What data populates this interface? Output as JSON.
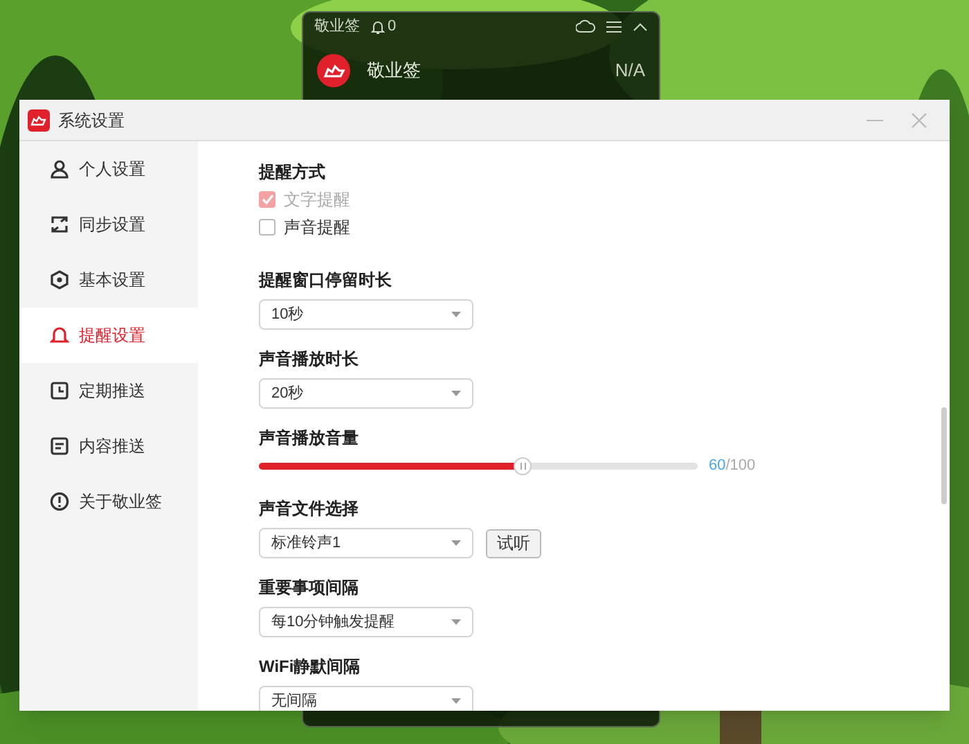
{
  "widget": {
    "title": "敬业签",
    "bell_count": "0",
    "name": "敬业签",
    "status": "N/A"
  },
  "window": {
    "title": "系统设置"
  },
  "sidebar": {
    "items": [
      {
        "label": "个人设置",
        "selected": false
      },
      {
        "label": "同步设置",
        "selected": false
      },
      {
        "label": "基本设置",
        "selected": false
      },
      {
        "label": "提醒设置",
        "selected": true
      },
      {
        "label": "定期推送",
        "selected": false
      },
      {
        "label": "内容推送",
        "selected": false
      },
      {
        "label": "关于敬业签",
        "selected": false
      }
    ]
  },
  "sections": [
    {
      "kind": "checks",
      "heading": "提醒方式",
      "options": [
        {
          "label": "文字提醒",
          "checked": true,
          "disabled": true
        },
        {
          "label": "声音提醒",
          "checked": false,
          "disabled": false
        }
      ]
    },
    {
      "kind": "select",
      "heading": "提醒窗口停留时长",
      "value": "10秒"
    },
    {
      "kind": "select",
      "heading": "声音播放时长",
      "value": "20秒"
    },
    {
      "kind": "slider",
      "heading": "声音播放音量",
      "level": 0.6,
      "reading": "60",
      "max": "/100"
    },
    {
      "kind": "select",
      "heading": "声音文件选择",
      "value": "标准铃声1",
      "button": "试听"
    },
    {
      "kind": "select",
      "heading": "重要事项间隔",
      "value": "每10分钟触发提醒"
    },
    {
      "kind": "select",
      "heading": "WiFi静默间隔",
      "value": "无间隔"
    }
  ]
}
